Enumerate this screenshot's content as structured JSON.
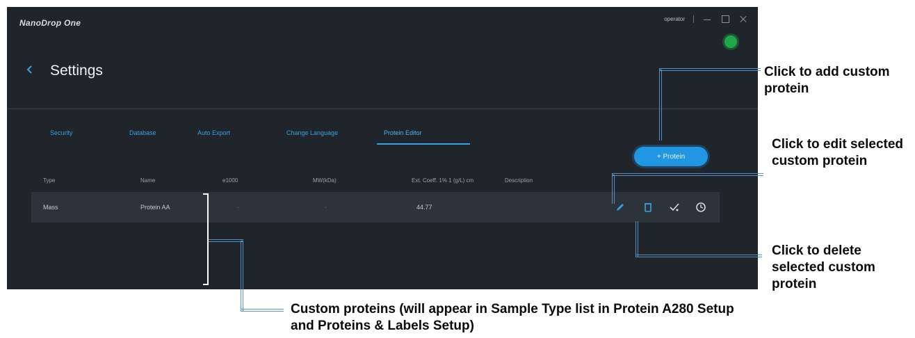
{
  "app": {
    "brand": "NanoDrop One",
    "user": "operator",
    "page_title": "Settings"
  },
  "tabs": [
    {
      "label": "Security",
      "active": false
    },
    {
      "label": "Database",
      "active": false
    },
    {
      "label": "Auto Export",
      "active": false
    },
    {
      "label": "Change Language",
      "active": false
    },
    {
      "label": "Protein Editor",
      "active": true
    }
  ],
  "add_button_label": "+ Protein",
  "table": {
    "columns": [
      "Type",
      "Name",
      "e1000",
      "MW(kDa)",
      "Ext. Coeff. 1% 1 (g/L) cm",
      "Description"
    ],
    "rows": [
      {
        "type": "Mass",
        "name": "Protein AA",
        "e1000": "-",
        "mw": "-",
        "ext_coeff": "44.77",
        "description": ""
      }
    ]
  },
  "icons": [
    "back-arrow-icon",
    "edit-pencil-icon",
    "delete-trash-icon",
    "check-icon",
    "history-icon"
  ],
  "colors": {
    "background": "#20252b",
    "row": "#2c333a",
    "accent": "#2196e3",
    "status": "#1fa84a"
  },
  "annotations": {
    "add": "Click to add custom protein",
    "edit": "Click to edit selected custom protein",
    "delete": "Click to delete selected custom protein",
    "custom_proteins": "Custom proteins (will appear in Sample Type list in Protein A280 Setup and Proteins & Labels Setup)"
  }
}
